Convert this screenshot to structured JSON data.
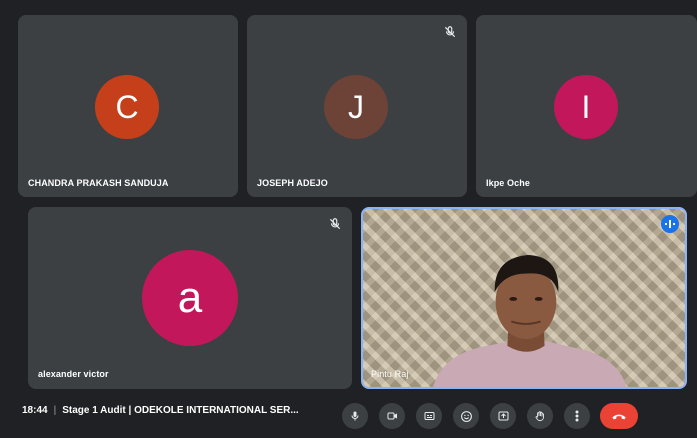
{
  "participants": [
    {
      "name": "CHANDRA PRAKASH SANDUJA",
      "initial": "C",
      "color": "#c5401a",
      "muted": false
    },
    {
      "name": "JOSEPH ADEJO",
      "initial": "J",
      "color": "#6d4237",
      "muted": true
    },
    {
      "name": "Ikpe Oche",
      "initial": "I",
      "color": "#c2185b",
      "muted": false
    },
    {
      "name": "alexander victor",
      "initial": "a",
      "color": "#c2185b",
      "muted": true
    },
    {
      "name": "Pintu Raj",
      "video": true,
      "speaking": true
    }
  ],
  "footer": {
    "time": "18:44",
    "meeting_title": "Stage 1 Audit | ODEKOLE INTERNATIONAL SER..."
  },
  "controls": [
    "microphone-icon",
    "camera-icon",
    "captions-icon",
    "emoji-icon",
    "present-icon",
    "raise-hand-icon",
    "more-options-icon",
    "hang-up-icon"
  ],
  "colors": {
    "background": "#202124",
    "tile": "#3c4043",
    "hang_up": "#ea4335",
    "active_border": "#8ab4f8"
  }
}
